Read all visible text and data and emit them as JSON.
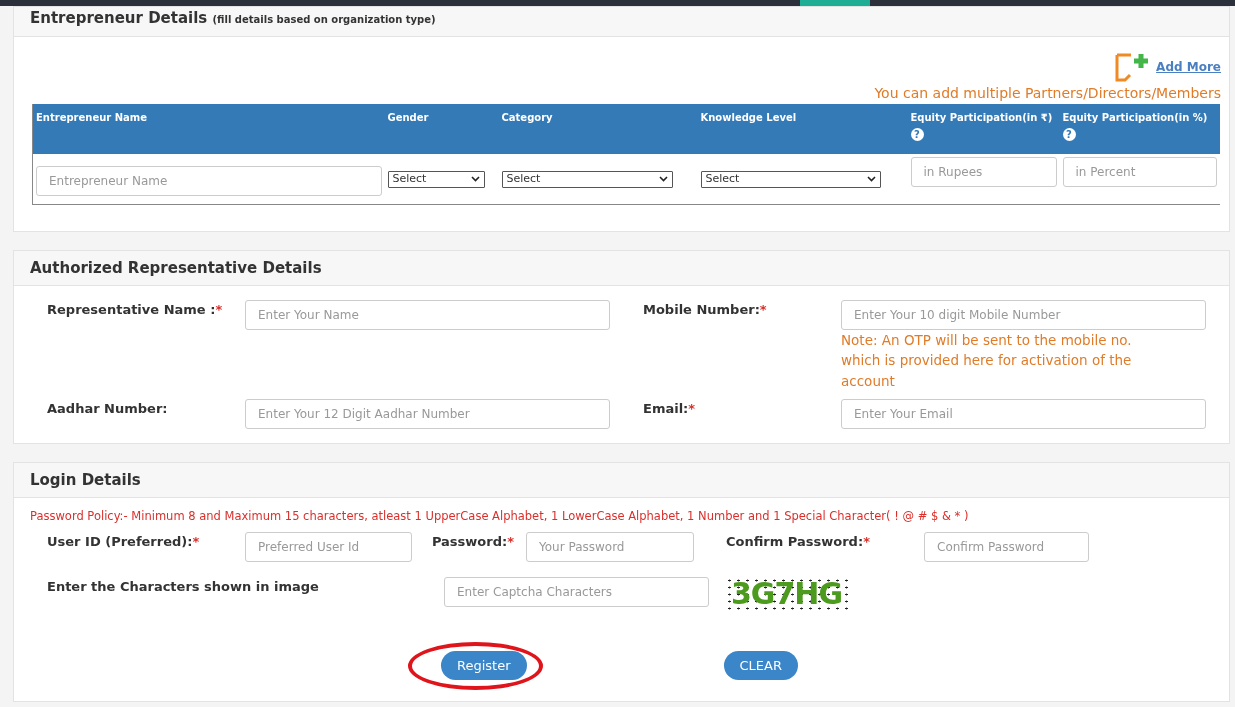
{
  "entrepreneur_section": {
    "title": "Entrepreneur Details",
    "subtitle": "(fill details based on organization type)",
    "add_more": "Add More",
    "note": "You can add multiple Partners/Directors/Members",
    "columns": [
      {
        "label": "Entrepreneur Name"
      },
      {
        "label": "Gender"
      },
      {
        "label": "Category"
      },
      {
        "label": "Knowledge Level"
      },
      {
        "label": "Equity Participation(in ₹)",
        "help_icon": "?"
      },
      {
        "label": "Equity Participation(in %)",
        "help_icon": "?"
      }
    ],
    "row": [
      {
        "kind": "input",
        "placeholder": "Entrepreneur Name"
      },
      {
        "kind": "select",
        "value": "Select"
      },
      {
        "kind": "select",
        "value": "Select"
      },
      {
        "kind": "select",
        "value": "Select"
      },
      {
        "kind": "input",
        "placeholder": "in Rupees"
      },
      {
        "kind": "input",
        "placeholder": "in Percent"
      }
    ]
  },
  "representative_section": {
    "title": "Authorized Representative Details",
    "fields": [
      {
        "label": "Representative Name :",
        "required_mark": "*",
        "placeholder": "Enter Your Name"
      },
      {
        "label": "Mobile Number:",
        "required_mark": "*",
        "placeholder": "Enter Your 10 digit Mobile Number",
        "note": "Note: An OTP will be sent to the mobile no. which is provided here for activation of the account"
      },
      {
        "label": "Aadhar Number:",
        "placeholder": "Enter Your 12 Digit Aadhar Number"
      },
      {
        "label": "Email:",
        "required_mark": "*",
        "placeholder": "Enter Your Email"
      }
    ]
  },
  "login_section": {
    "title": "Login Details",
    "policy": "Password Policy:- Minimum 8 and Maximum 15 characters, atleast 1 UpperCase Alphabet, 1 LowerCase Alphabet, 1 Number and 1 Special Character( ! @ # $ & * )",
    "fields": [
      {
        "label": "User ID (Preferred):",
        "required_mark": "*",
        "placeholder": "Preferred User Id"
      },
      {
        "label": "Password:",
        "required_mark": "*",
        "placeholder": "Your Password"
      },
      {
        "label": "Confirm Password:",
        "required_mark": "*",
        "placeholder": "Confirm Password"
      }
    ],
    "captcha_label": "Enter the Characters shown in image",
    "captcha_placeholder": "Enter Captcha Characters",
    "captcha": "3G7HG",
    "buttons": [
      {
        "label": "Register"
      },
      {
        "label": "CLEAR"
      }
    ],
    "register_circled": true
  }
}
